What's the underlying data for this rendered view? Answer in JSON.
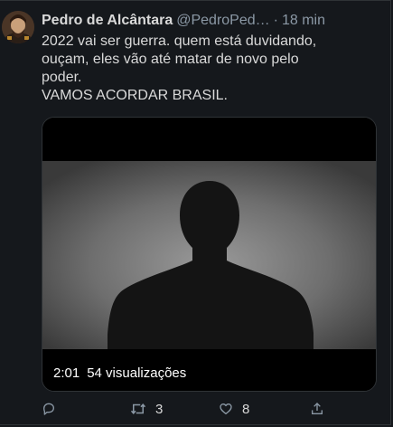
{
  "tweet": {
    "author_name": "Pedro de Alcântara",
    "author_handle": "@PedroPed…",
    "separator": "·",
    "timestamp": "18 min",
    "text_lines": [
      "2022 vai ser guerra. quem está duvidando,",
      "ouçam, eles vão até matar de novo pelo",
      "poder.",
      "VAMOS ACORDAR BRASIL."
    ],
    "media": {
      "duration": "2:01",
      "views": "54 visualizações"
    },
    "actions": {
      "reply": {
        "icon": "reply-icon",
        "count": ""
      },
      "retweet": {
        "icon": "retweet-icon",
        "count": "3"
      },
      "like": {
        "icon": "like-icon",
        "count": "8"
      },
      "share": {
        "icon": "share-icon",
        "count": ""
      }
    }
  },
  "colors": {
    "background": "#15181c",
    "text": "#d9d9d9",
    "muted": "#8b98a5",
    "border": "#2f3336"
  }
}
